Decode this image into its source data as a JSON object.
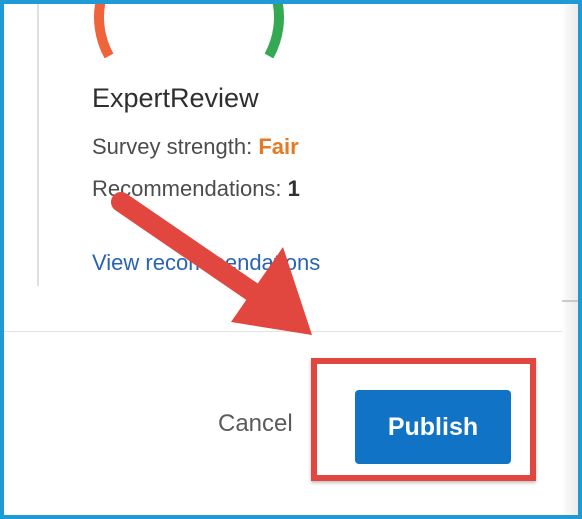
{
  "card": {
    "title": "ExpertReview",
    "strength_label": "Survey strength: ",
    "strength_value": "Fair",
    "recommendations_label": "Recommendations: ",
    "recommendations_count": "1",
    "view_link": "View recommendations"
  },
  "footer": {
    "cancel_label": "Cancel",
    "publish_label": "Publish"
  },
  "colors": {
    "frame_border": "#1e9ad6",
    "publish_bg": "#1073c6",
    "fair": "#e57a24",
    "link": "#2a63b4",
    "annotation": "#e1463f",
    "gauge_left": "#f0643c",
    "gauge_right": "#35a853"
  }
}
